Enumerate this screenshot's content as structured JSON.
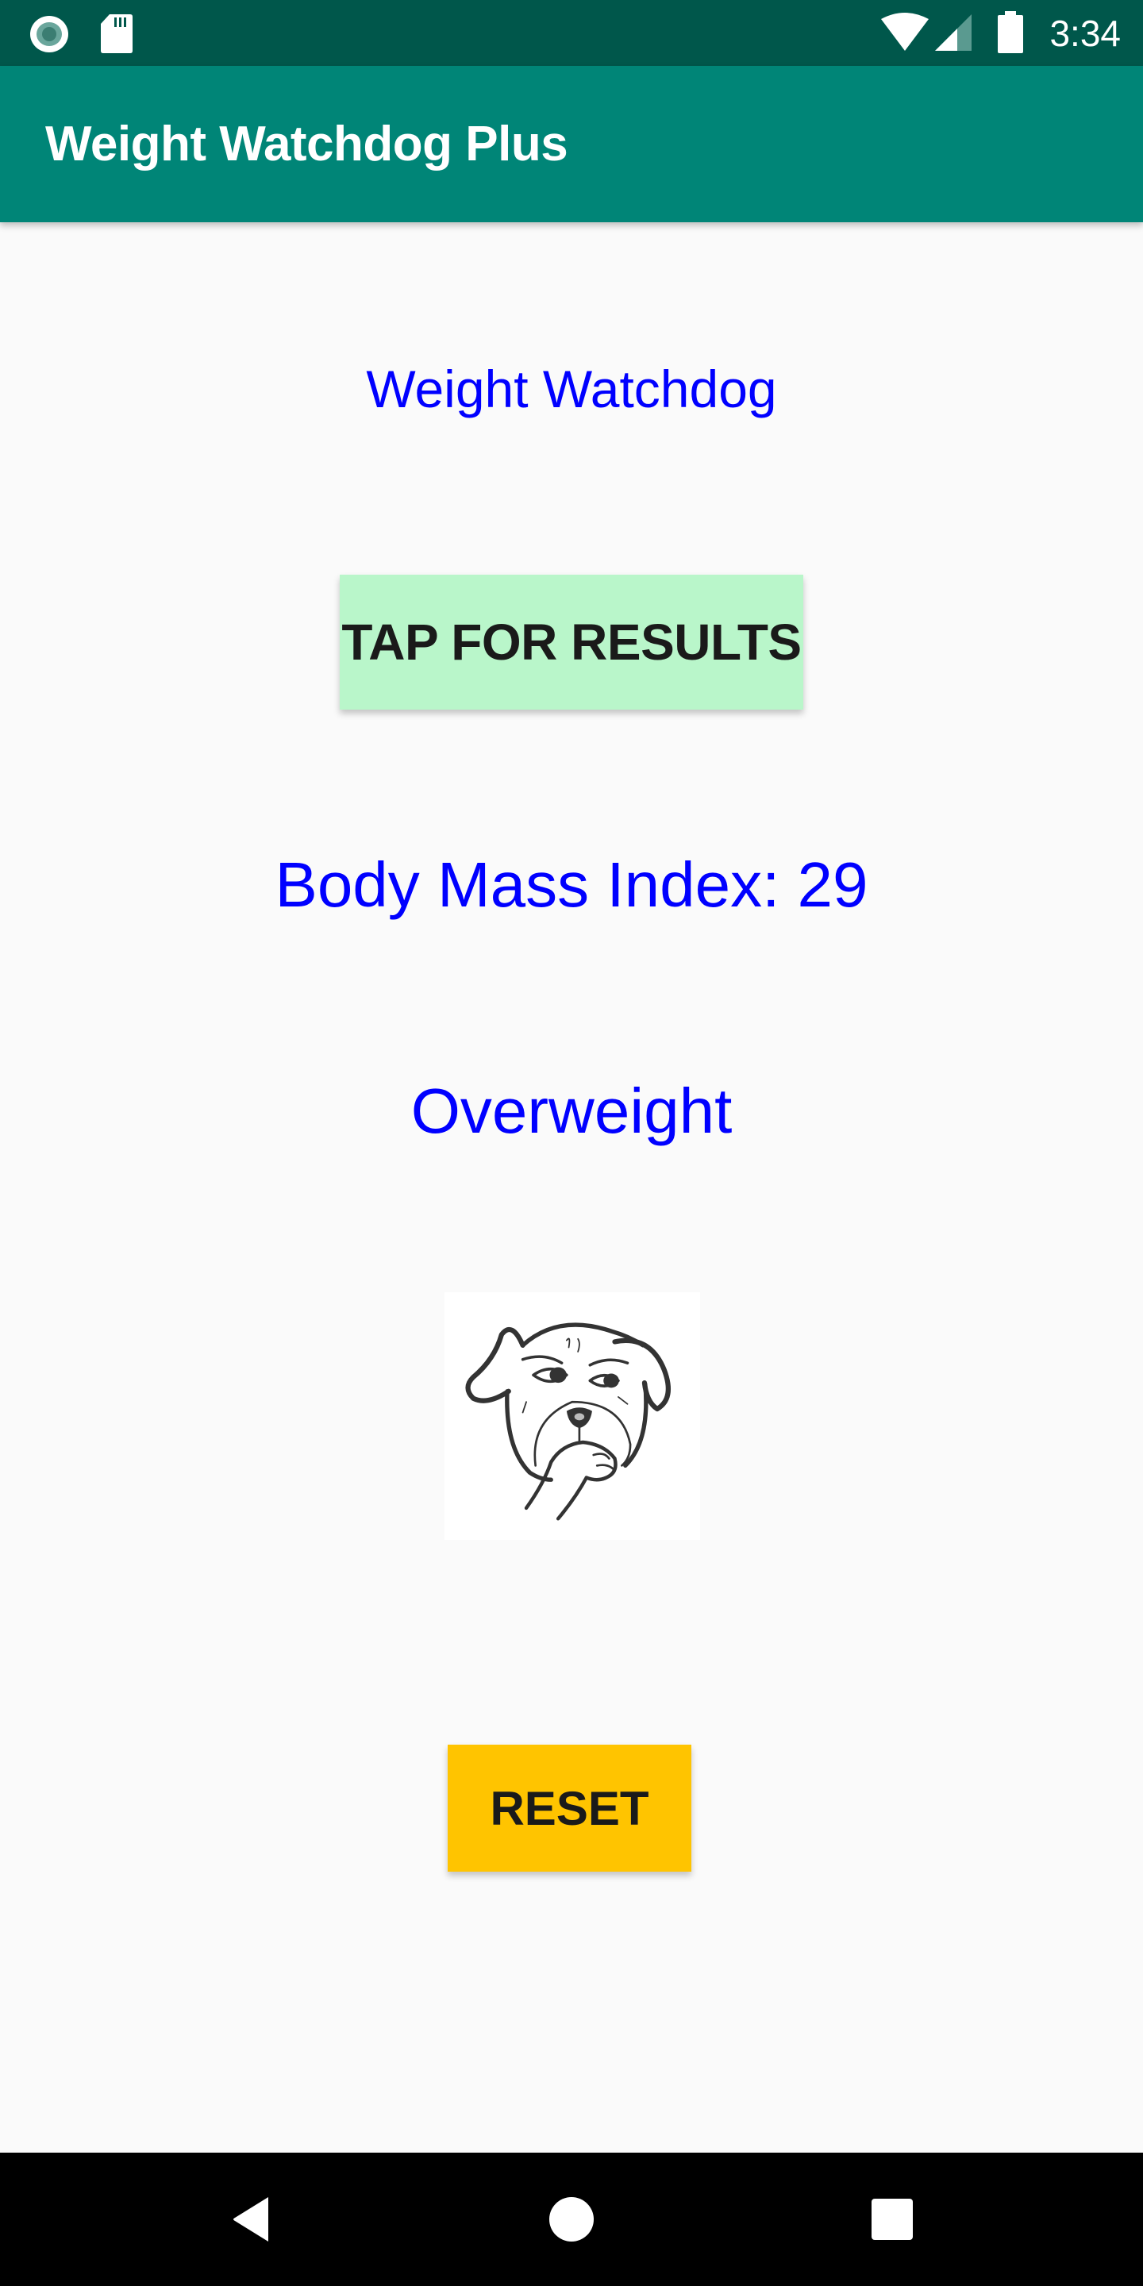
{
  "status_bar": {
    "time": "3:34",
    "left_icons": [
      "sync-circle-icon",
      "sd-card-icon"
    ],
    "right_icons": [
      "wifi-icon",
      "cell-signal-icon",
      "battery-icon"
    ]
  },
  "app_bar": {
    "title": "Weight Watchdog Plus",
    "color": "#008577"
  },
  "main": {
    "heading": "Weight Watchdog",
    "tap_button_label": "TAP FOR RESULTS",
    "bmi_label": "Body Mass Index: 29",
    "bmi_value": 29,
    "category": "Overweight",
    "image": "worried-dog-illustration",
    "reset_button_label": "RESET",
    "text_color": "#0000FF",
    "tap_button_color": "#B9F6CA",
    "reset_button_color": "#FFC400"
  },
  "nav_bar": {
    "buttons": [
      "back-icon",
      "home-icon",
      "recents-icon"
    ]
  }
}
